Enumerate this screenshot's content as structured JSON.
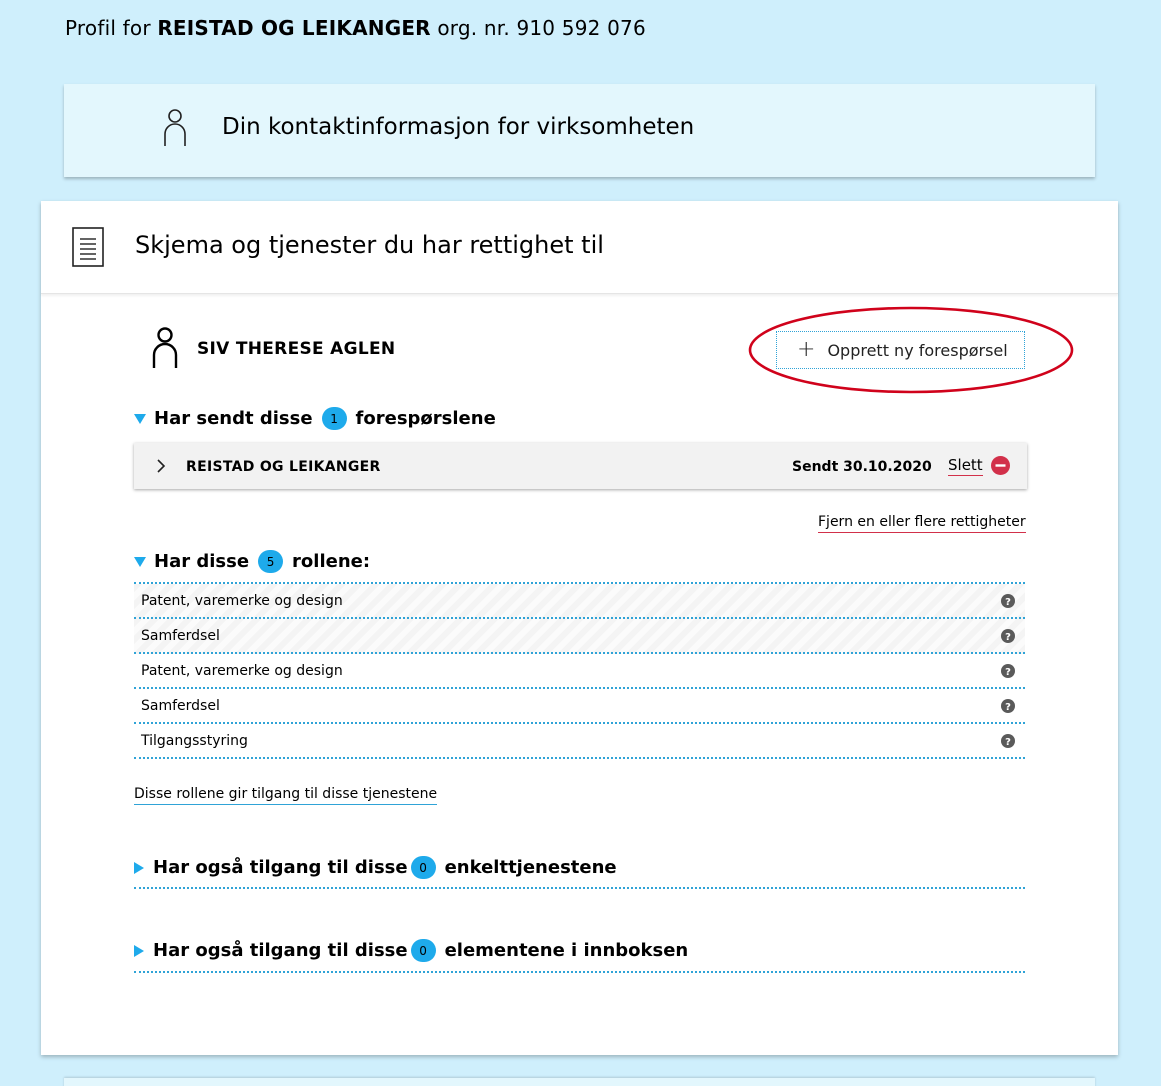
{
  "profile": {
    "prefix": "Profil for",
    "org_name": "REISTAD OG LEIKANGER",
    "org_nr_label": "org. nr.",
    "org_nr": "910 592 076"
  },
  "contact_card": {
    "title": "Din kontaktinformasjon for virksomheten",
    "icon": "person-icon"
  },
  "forms_card": {
    "title": "Skjema og tjenester du har rettighet til",
    "icon": "document-icon"
  },
  "person": {
    "name": "SIV THERESE AGLEN",
    "new_request_label": "Opprett ny forespørsel"
  },
  "sent_requests": {
    "label_before": "Har sendt disse",
    "count": "1",
    "label_after": "forespørslene",
    "items": [
      {
        "org": "REISTAD OG LEIKANGER",
        "sent": "Sendt 30.10.2020",
        "delete_label": "Slett"
      }
    ]
  },
  "remove_rights_label": "Fjern en eller flere rettigheter",
  "roles": {
    "label_before": "Har disse",
    "count": "5",
    "label_after": "rollene:",
    "items": [
      {
        "name": "Patent, varemerke og design"
      },
      {
        "name": "Samferdsel"
      },
      {
        "name": "Patent, varemerke og design"
      },
      {
        "name": "Samferdsel"
      },
      {
        "name": "Tilgangsstyring"
      }
    ]
  },
  "roles_services_link": "Disse rollene gir tilgang til disse tjenestene",
  "single_services": {
    "label_before": "Har også tilgang til disse",
    "count": "0",
    "label_after": "enkelttjenestene"
  },
  "inbox_elements": {
    "label_before": "Har også tilgang til disse",
    "count": "0",
    "label_after": "elementene i innboksen"
  },
  "colors": {
    "page_bg": "#cfeffc",
    "accent": "#1eaaeb",
    "danger": "#d2304a",
    "annotation": "#d0021b"
  }
}
